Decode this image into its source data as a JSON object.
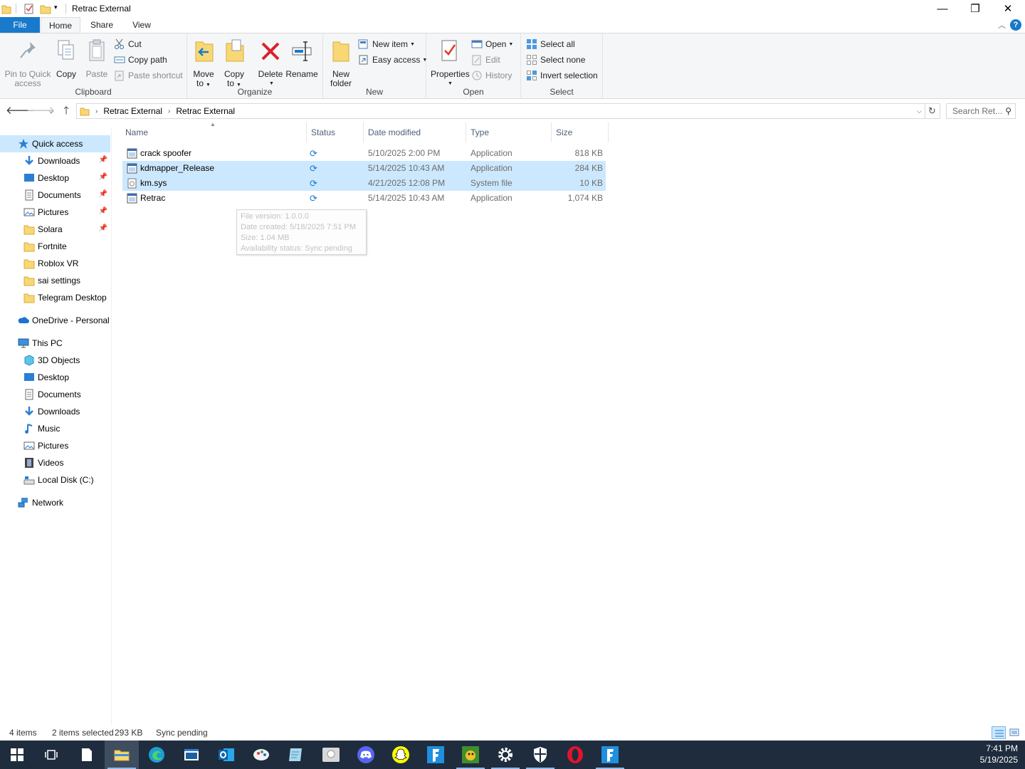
{
  "window": {
    "title": "Retrac External",
    "controls": {
      "minimize": "—",
      "restore": "❐",
      "close": "✕"
    }
  },
  "ribbon_tabs": [
    "File",
    "Home",
    "Share",
    "View"
  ],
  "help": "?",
  "ribbon": {
    "clipboard": {
      "label": "Clipboard",
      "pin_line1": "Pin to Quick",
      "pin_line2": "access",
      "copy": "Copy",
      "paste": "Paste",
      "cut": "Cut",
      "copy_path": "Copy path",
      "paste_shortcut": "Paste shortcut"
    },
    "organize": {
      "label": "Organize",
      "move_line1": "Move",
      "move_line2": "to",
      "copy_line1": "Copy",
      "copy_line2": "to",
      "delete": "Delete",
      "rename": "Rename"
    },
    "new": {
      "label": "New",
      "folder_line1": "New",
      "folder_line2": "folder",
      "new_item": "New item",
      "easy_access": "Easy access"
    },
    "open": {
      "label": "Open",
      "properties": "Properties",
      "open": "Open",
      "edit": "Edit",
      "history": "History"
    },
    "select": {
      "label": "Select",
      "select_all": "Select all",
      "select_none": "Select none",
      "invert": "Invert selection"
    }
  },
  "address": {
    "crumbs": [
      "Retrac External",
      "Retrac External"
    ],
    "search_placeholder": "Search Ret..."
  },
  "nav": {
    "quick_access": "Quick access",
    "quick_items": [
      {
        "label": "Downloads",
        "pinned": true
      },
      {
        "label": "Desktop",
        "pinned": true
      },
      {
        "label": "Documents",
        "pinned": true
      },
      {
        "label": "Pictures",
        "pinned": true
      },
      {
        "label": "Solara",
        "pinned": true
      },
      {
        "label": "Fortnite",
        "pinned": false
      },
      {
        "label": "Roblox VR",
        "pinned": false
      },
      {
        "label": "sai settings",
        "pinned": false
      },
      {
        "label": "Telegram Desktop",
        "pinned": false
      }
    ],
    "onedrive": "OneDrive - Personal",
    "this_pc": "This PC",
    "pc_items": [
      "3D Objects",
      "Desktop",
      "Documents",
      "Downloads",
      "Music",
      "Pictures",
      "Videos",
      "Local Disk (C:)"
    ],
    "network": "Network"
  },
  "columns": {
    "name": "Name",
    "status": "Status",
    "date": "Date modified",
    "type": "Type",
    "size": "Size"
  },
  "files": [
    {
      "name": "crack spoofer",
      "date": "5/10/2025 2:00 PM",
      "type": "Application",
      "size": "818 KB",
      "selected": false
    },
    {
      "name": "kdmapper_Release",
      "date": "5/14/2025 10:43 AM",
      "type": "Application",
      "size": "284 KB",
      "selected": true
    },
    {
      "name": "km.sys",
      "date": "4/21/2025 12:08 PM",
      "type": "System file",
      "size": "10 KB",
      "selected": true
    },
    {
      "name": "Retrac",
      "date": "5/14/2025 10:43 AM",
      "type": "Application",
      "size": "1,074 KB",
      "selected": false
    }
  ],
  "tooltip": {
    "line1": "File version: 1.0.0.0",
    "line2": "Date created: 5/18/2025 7:51 PM",
    "line3": "Size: 1.04 MB",
    "line4": "Availability status: Sync pending"
  },
  "statusbar": {
    "count": "4 items",
    "selected": "2 items selected",
    "size": "293 KB",
    "sync": "Sync pending"
  },
  "taskbar": {
    "time": "7:41 PM",
    "date": "5/19/2025",
    "apps": [
      "start-icon",
      "task-view-icon",
      "notepad-icon",
      "file-explorer-icon",
      "edge-icon",
      "app-window-icon",
      "outlook-icon",
      "paint-icon",
      "notes-icon",
      "installer-icon",
      "discord-icon",
      "snapchat-icon",
      "fortnite-icon",
      "game-icon",
      "settings-icon",
      "security-icon",
      "opera-icon",
      "fortnite-icon-2"
    ]
  },
  "colors": {
    "accent": "#1979ca",
    "selection": "#cce8ff",
    "taskbar": "#1e2c3e",
    "header_text": "#4c607a"
  }
}
